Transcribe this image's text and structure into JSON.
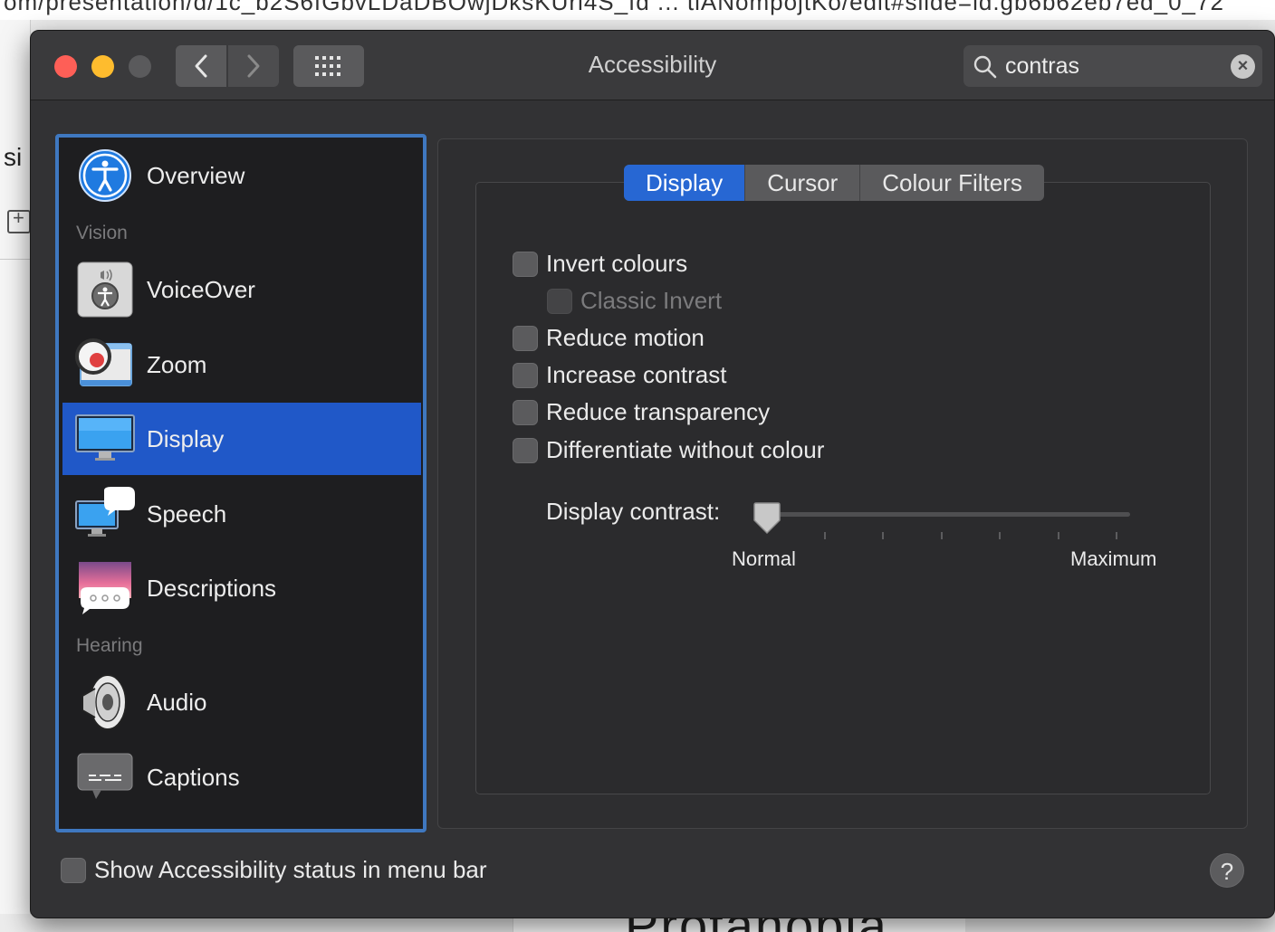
{
  "window": {
    "title": "Accessibility",
    "search_value": "contras"
  },
  "sidebar": {
    "items": [
      {
        "label": "Overview",
        "icon": "accessibility-icon"
      },
      {
        "header": "Vision"
      },
      {
        "label": "VoiceOver",
        "icon": "voiceover-icon"
      },
      {
        "label": "Zoom",
        "icon": "zoom-icon"
      },
      {
        "label": "Display",
        "icon": "display-icon",
        "selected": true
      },
      {
        "label": "Speech",
        "icon": "speech-icon"
      },
      {
        "label": "Descriptions",
        "icon": "descriptions-icon"
      },
      {
        "header": "Hearing"
      },
      {
        "label": "Audio",
        "icon": "speaker-icon"
      },
      {
        "label": "Captions",
        "icon": "captions-icon"
      }
    ]
  },
  "tabs": [
    {
      "label": "Display",
      "active": true
    },
    {
      "label": "Cursor"
    },
    {
      "label": "Colour Filters"
    }
  ],
  "options": [
    {
      "label": "Invert colours",
      "checked": false
    },
    {
      "label": "Classic Invert",
      "checked": false,
      "disabled": true
    },
    {
      "label": "Reduce motion",
      "checked": false
    },
    {
      "label": "Increase contrast",
      "checked": false
    },
    {
      "label": "Reduce transparency",
      "checked": false
    },
    {
      "label": "Differentiate without colour",
      "checked": false
    }
  ],
  "contrast": {
    "label": "Display contrast:",
    "min_label": "Normal",
    "max_label": "Maximum",
    "value": 0
  },
  "footer": {
    "status_menu_label": "Show Accessibility status in menu bar",
    "help_label": "?"
  },
  "colors": {
    "accent": "#2767d3",
    "selection": "#2058c8",
    "window_bg": "#323234"
  }
}
